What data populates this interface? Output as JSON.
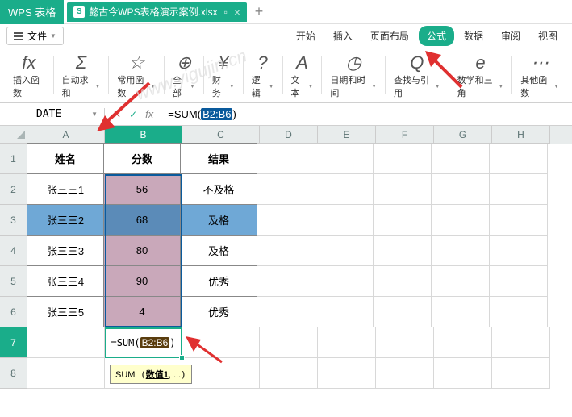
{
  "app_name": "WPS 表格",
  "tab_title": "懿古今WPS表格演示案例.xlsx",
  "file_menu": "文件",
  "menu_tabs": [
    "开始",
    "插入",
    "页面布局",
    "公式",
    "数据",
    "审阅",
    "视图"
  ],
  "active_menu_tab": 3,
  "ribbon": [
    {
      "icon": "fx",
      "label": "插入函数",
      "dd": false
    },
    {
      "icon": "Σ",
      "label": "自动求和",
      "dd": true
    },
    {
      "icon": "☆",
      "label": "常用函数",
      "dd": true
    },
    {
      "icon": "⊕",
      "label": "全部",
      "dd": true
    },
    {
      "icon": "¥",
      "label": "财务",
      "dd": true
    },
    {
      "icon": "?",
      "label": "逻辑",
      "dd": true
    },
    {
      "icon": "A",
      "label": "文本",
      "dd": true
    },
    {
      "icon": "◷",
      "label": "日期和时间",
      "dd": true
    },
    {
      "icon": "Q",
      "label": "查找与引用",
      "dd": true
    },
    {
      "icon": "e",
      "label": "数学和三角",
      "dd": true
    },
    {
      "icon": "⋯",
      "label": "其他函数",
      "dd": true
    }
  ],
  "namebox": "DATE",
  "formula": {
    "prefix": "=SUM(",
    "sel": "B2:B6",
    "suffix": ")"
  },
  "columns": [
    "A",
    "B",
    "C",
    "D",
    "E",
    "F",
    "G",
    "H"
  ],
  "rows": [
    "1",
    "2",
    "3",
    "4",
    "5",
    "6",
    "7",
    "8"
  ],
  "headers": {
    "A": "姓名",
    "B": "分数",
    "C": "结果"
  },
  "data": [
    {
      "name": "张三三1",
      "score": "56",
      "result": "不及格"
    },
    {
      "name": "张三三2",
      "score": "68",
      "result": "及格",
      "hl": true
    },
    {
      "name": "张三三3",
      "score": "80",
      "result": "及格"
    },
    {
      "name": "张三三4",
      "score": "90",
      "result": "优秀"
    },
    {
      "name": "张三三5",
      "score": "4",
      "result": "优秀"
    }
  ],
  "active_cell_formula": {
    "prefix": "=SUM(",
    "sel": "B2:B6",
    "suffix": ")"
  },
  "tooltip": {
    "fn": "SUM",
    "arg": "数值1",
    "rest": ", ..."
  },
  "watermark": "www.yigujin.cn",
  "chart_data": {
    "type": "table",
    "columns": [
      "姓名",
      "分数",
      "结果"
    ],
    "rows": [
      [
        "张三三1",
        56,
        "不及格"
      ],
      [
        "张三三2",
        68,
        "及格"
      ],
      [
        "张三三3",
        80,
        "及格"
      ],
      [
        "张三三4",
        90,
        "优秀"
      ],
      [
        "张三三5",
        4,
        "优秀"
      ]
    ],
    "formula": "=SUM(B2:B6)"
  }
}
